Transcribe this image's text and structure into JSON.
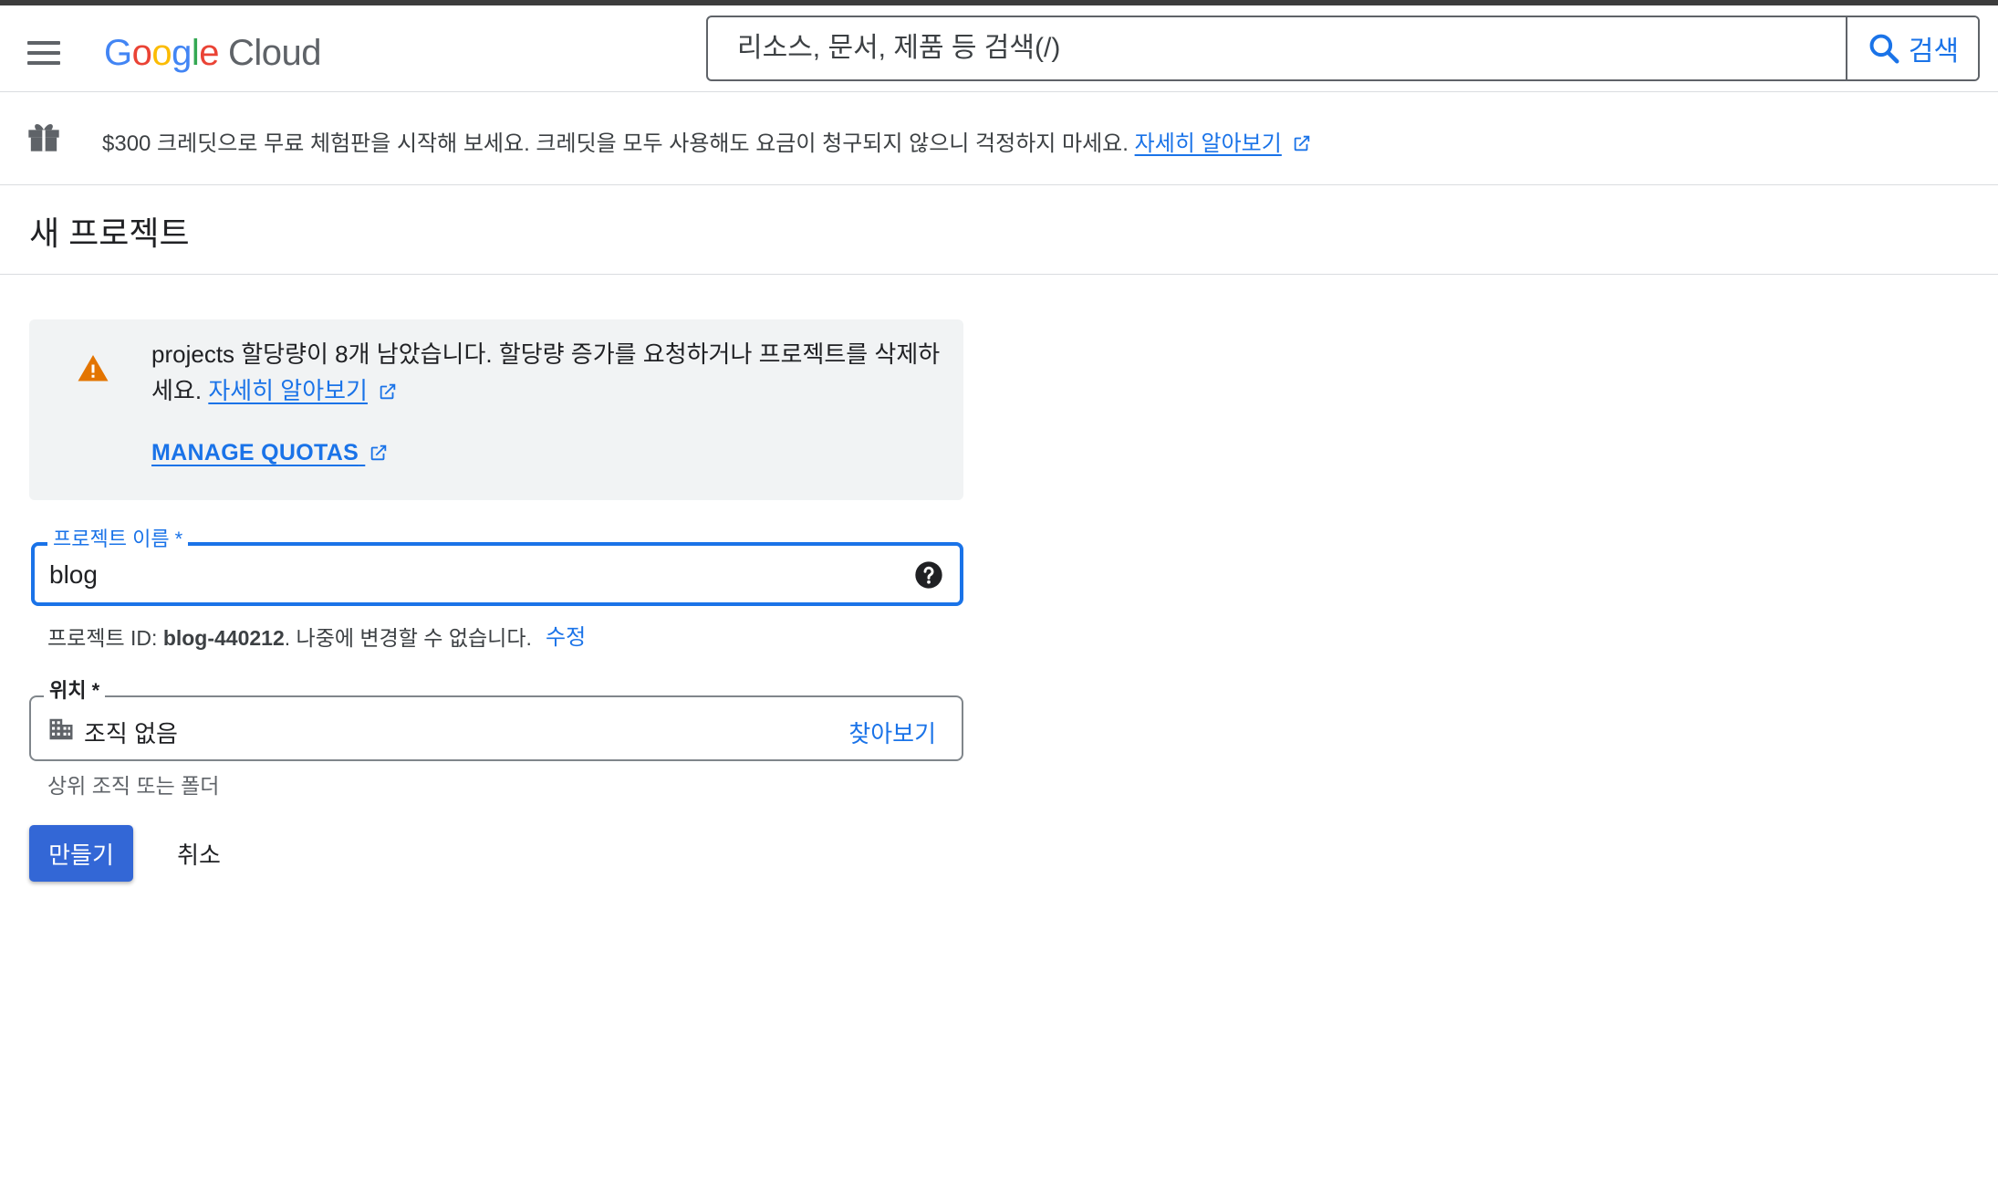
{
  "header": {
    "logo": {
      "g1": "G",
      "o1": "o",
      "o2": "o",
      "g2": "g",
      "l": "l",
      "e": "e",
      "product": "Cloud"
    },
    "search": {
      "placeholder": "리소스, 문서, 제품 등 검색(/)",
      "button_label": "검색"
    }
  },
  "banner": {
    "text": "$300 크레딧으로 무료 체험판을 시작해 보세요. 크레딧을 모두 사용해도 요금이 청구되지 않으니 걱정하지 마세요.",
    "link": "자세히 알아보기"
  },
  "page": {
    "title": "새 프로젝트"
  },
  "warning": {
    "text": "projects 할당량이 8개 남았습니다. 할당량 증가를 요청하거나 프로젝트를 삭제하세요.",
    "learn_more": "자세히 알아보기",
    "manage_quotas": "MANAGE QUOTAS"
  },
  "form": {
    "project_name": {
      "label": "프로젝트 이름 *",
      "value": "blog"
    },
    "project_id": {
      "prefix": "프로젝트 ID: ",
      "id": "blog-440212",
      "suffix": ". 나중에 변경할 수 없습니다.",
      "edit": "수정"
    },
    "location": {
      "label": "위치 *",
      "value": "조직 없음",
      "browse": "찾아보기",
      "helper": "상위 조직 또는 폴더"
    }
  },
  "actions": {
    "create": "만들기",
    "cancel": "취소"
  },
  "colors": {
    "primary": "#1a73e8",
    "button": "#3367d6",
    "warning_icon": "#e37400"
  }
}
